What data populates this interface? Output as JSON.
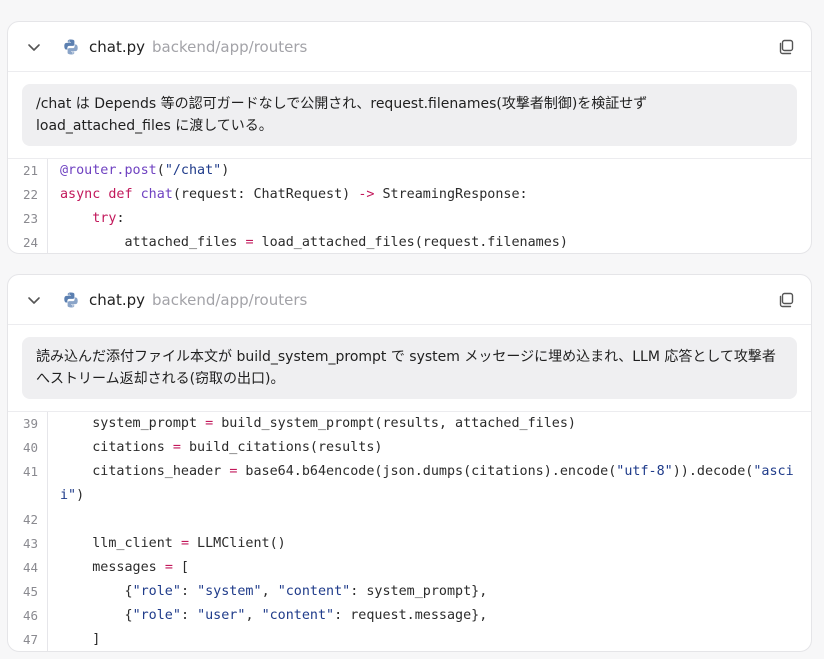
{
  "cards": [
    {
      "file_name": "chat.py",
      "file_path": "backend/app/routers",
      "note": "/chat は Depends 等の認可ガードなしで公開され、request.filenames(攻撃者制御)を検証せず load_attached_files に渡している。",
      "lines": [
        {
          "num": "21",
          "text": "@router.post(\"/chat\")"
        },
        {
          "num": "22",
          "text": "async def chat(request: ChatRequest) -> StreamingResponse:"
        },
        {
          "num": "23",
          "text": "    try:"
        },
        {
          "num": "24",
          "text": "        attached_files = load_attached_files(request.filenames)"
        }
      ]
    },
    {
      "file_name": "chat.py",
      "file_path": "backend/app/routers",
      "note": "読み込んだ添付ファイル本文が build_system_prompt で system メッセージに埋め込まれ、LLM 応答として攻撃者へストリーム返却される(窃取の出口)。",
      "lines": [
        {
          "num": "39",
          "text": "    system_prompt = build_system_prompt(results, attached_files)"
        },
        {
          "num": "40",
          "text": "    citations = build_citations(results)"
        },
        {
          "num": "41",
          "text": "    citations_header = base64.b64encode(json.dumps(citations).encode(\"utf-8\")).decode(\"ascii\")"
        },
        {
          "num": "42",
          "text": ""
        },
        {
          "num": "43",
          "text": "    llm_client = LLMClient()"
        },
        {
          "num": "44",
          "text": "    messages = ["
        },
        {
          "num": "45",
          "text": "        {\"role\": \"system\", \"content\": system_prompt},"
        },
        {
          "num": "46",
          "text": "        {\"role\": \"user\", \"content\": request.message},"
        },
        {
          "num": "47",
          "text": "    ]"
        }
      ]
    }
  ],
  "icons": {
    "collapse": "chevron-down-icon",
    "file": "python-icon",
    "copy": "copy-icon"
  },
  "colors": {
    "keyword": "#c2185b",
    "function": "#6f42c1",
    "string": "#1f3b8a"
  }
}
